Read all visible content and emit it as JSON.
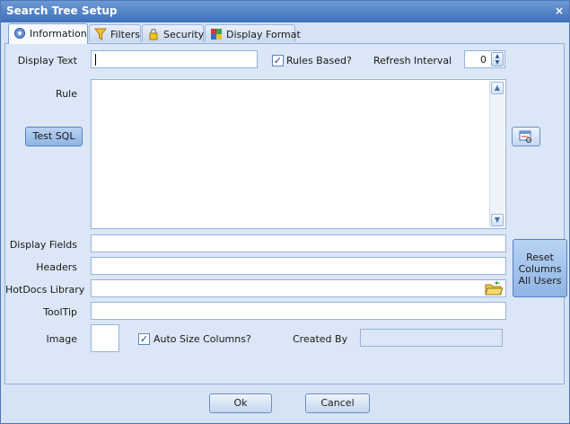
{
  "window": {
    "title": "Search Tree Setup",
    "close_glyph": "×"
  },
  "tabs": [
    {
      "label": "Information",
      "icon": "gear-icon"
    },
    {
      "label": "Filters",
      "icon": "funnel-icon"
    },
    {
      "label": "Security",
      "icon": "lock-icon"
    },
    {
      "label": "Display Format",
      "icon": "palette-icon"
    }
  ],
  "form": {
    "display_text_label": "Display Text",
    "display_text_value": "",
    "rules_based_label": "Rules Based?",
    "rules_based_checked": true,
    "refresh_interval_label": "Refresh Interval",
    "refresh_interval_value": "0",
    "rule_label": "Rule",
    "test_sql_label": "Test SQL",
    "display_fields_label": "Display Fields",
    "headers_label": "Headers",
    "hotdocs_library_label": "HotDocs Library",
    "tooltip_label": "ToolTip",
    "image_label": "Image",
    "auto_size_label": "Auto Size Columns?",
    "auto_size_checked": true,
    "created_by_label": "Created By",
    "reset_columns_label": "Reset Columns All Users"
  },
  "footer": {
    "ok_label": "Ok",
    "cancel_label": "Cancel"
  },
  "colors": {
    "titlebar": "#3e6fb8",
    "panel": "#dbe6f6",
    "accent": "#5a80be"
  }
}
